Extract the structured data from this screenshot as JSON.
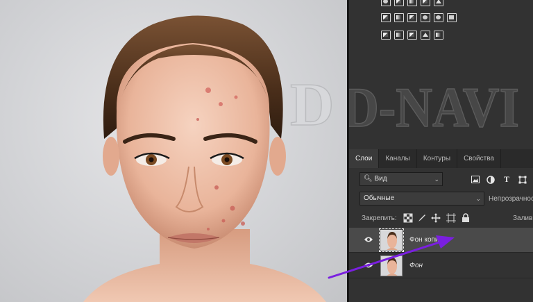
{
  "watermark": {
    "text": "D-NAVI"
  },
  "layers_panel": {
    "tabs": [
      {
        "label": "Слои",
        "active": true
      },
      {
        "label": "Каналы",
        "active": false
      },
      {
        "label": "Контуры",
        "active": false
      },
      {
        "label": "Свойства",
        "active": false
      }
    ],
    "filter": {
      "value": "Вид",
      "icon": "search-icon"
    },
    "filter_icons": [
      "image-filter-icon",
      "adjustment-filter-icon",
      "type-filter-icon",
      "shape-filter-icon"
    ],
    "blend_mode": {
      "value": "Обычные"
    },
    "opacity_label": "Непрозрачность:",
    "lock_label": "Закрепить:",
    "lock_icons": [
      "lock-transparent-icon",
      "lock-image-icon",
      "lock-position-icon",
      "lock-artboard-icon",
      "lock-all-icon"
    ],
    "fill_label": "Заливка:",
    "layers": [
      {
        "name": "Фон копия",
        "visible": true,
        "selected": true,
        "italic": false
      },
      {
        "name": "Фон",
        "visible": true,
        "selected": false,
        "italic": true
      }
    ]
  },
  "colors": {
    "panel_bg": "#323232",
    "selected_layer": "#4a4a4a",
    "arrow": "#7a1fe0"
  }
}
